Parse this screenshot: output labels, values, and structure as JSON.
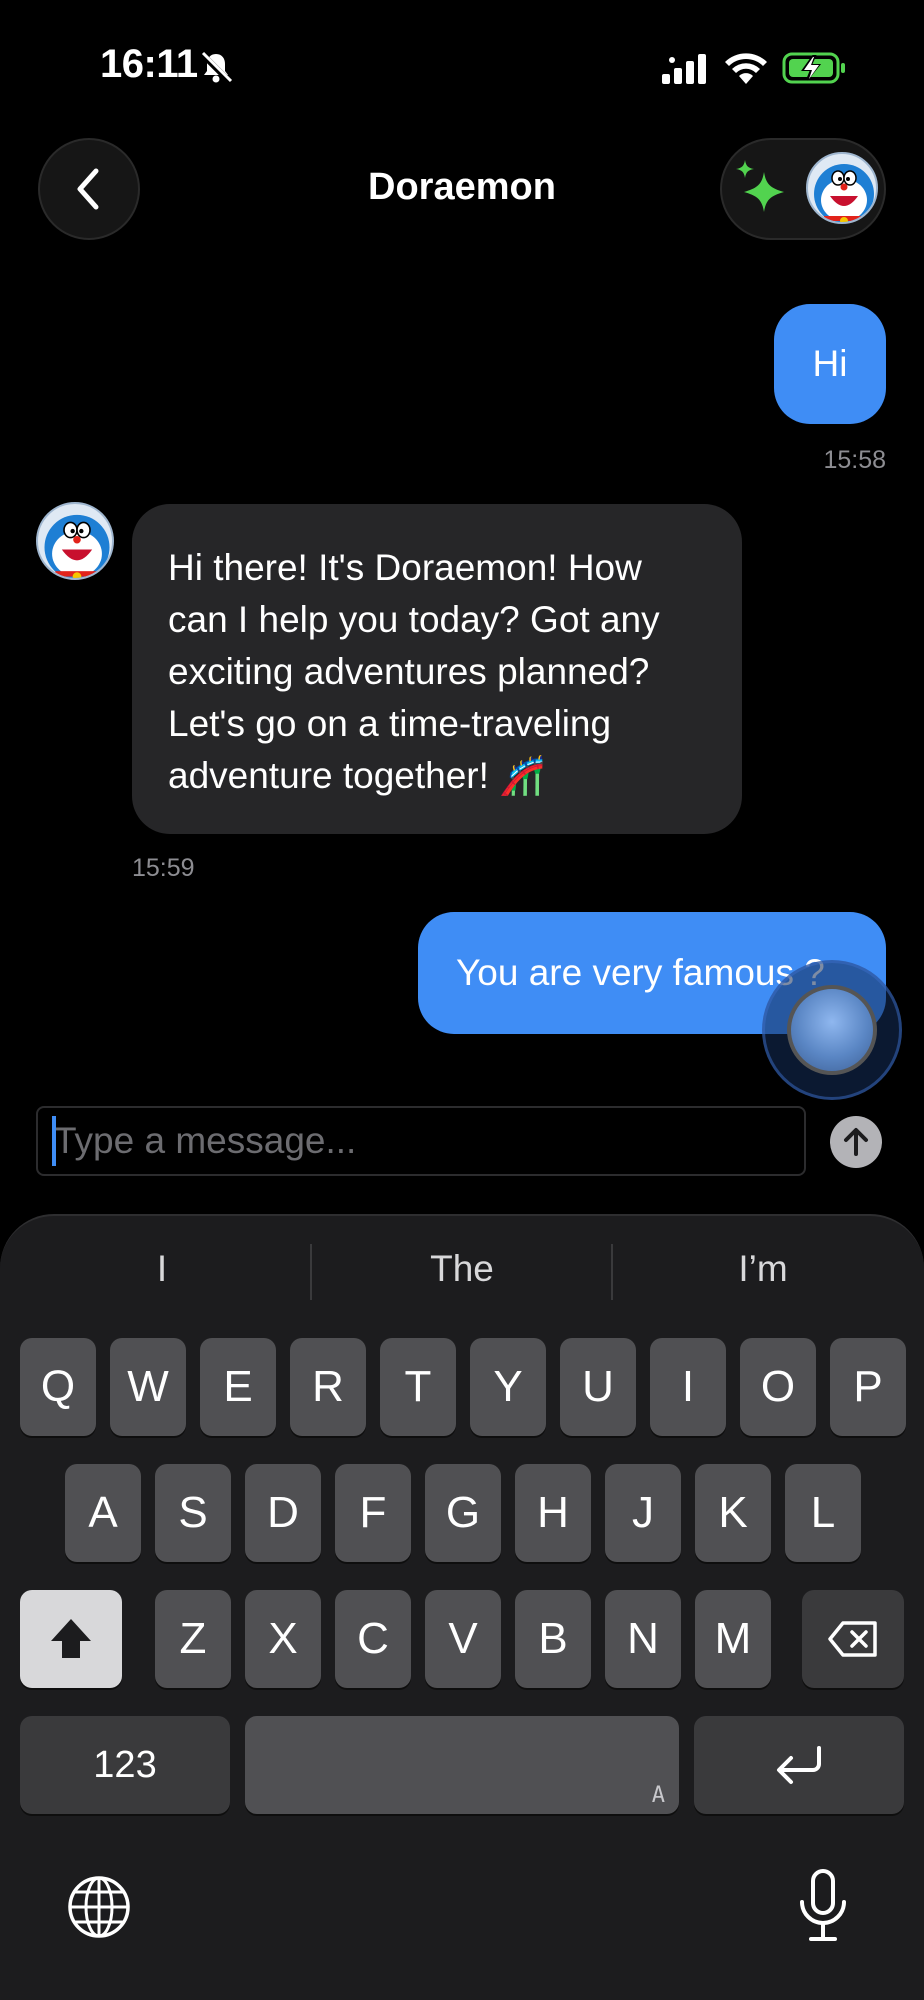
{
  "status_bar": {
    "time": "16:11"
  },
  "header": {
    "title": "Doraemon"
  },
  "messages": [
    {
      "sender": "user",
      "text": "Hi",
      "time": "15:58"
    },
    {
      "sender": "bot",
      "lines": [
        "Hi there! It's Doraemon! How",
        "can I help you today? Got any",
        "exciting adventures planned?",
        "Let's go on a time-traveling",
        "adventure together! 🎢"
      ],
      "time": "15:59"
    },
    {
      "sender": "user",
      "text": "You are very famous ?"
    }
  ],
  "composer": {
    "placeholder": "Type a message..."
  },
  "keyboard": {
    "suggestions": [
      "I",
      "The",
      "I’m"
    ],
    "row1": [
      "Q",
      "W",
      "E",
      "R",
      "T",
      "Y",
      "U",
      "I",
      "O",
      "P"
    ],
    "row2": [
      "A",
      "S",
      "D",
      "F",
      "G",
      "H",
      "J",
      "K",
      "L"
    ],
    "row3": [
      "Z",
      "X",
      "C",
      "V",
      "B",
      "N",
      "M"
    ],
    "numbers_key": "123",
    "space_hint": "A",
    "icons": {
      "shift": "shift-icon",
      "delete": "delete-icon",
      "return": "return-icon",
      "globe": "globe-icon",
      "mic": "microphone-icon"
    }
  },
  "colors": {
    "accent": "#3f8df5",
    "bubble_bot": "#262628",
    "sparkle": "#52d34f"
  }
}
